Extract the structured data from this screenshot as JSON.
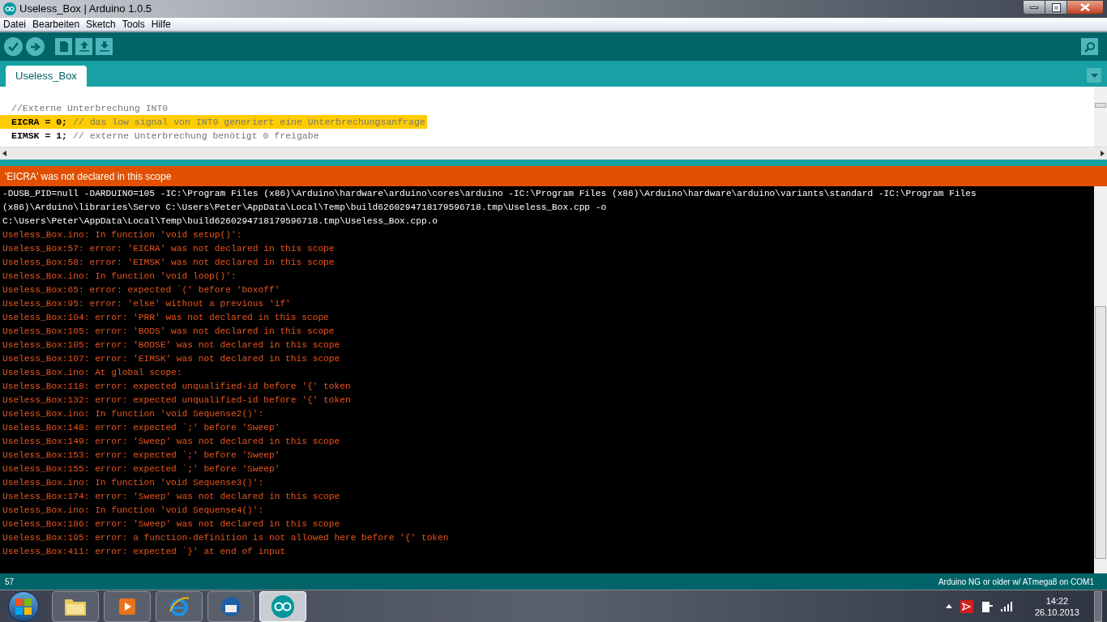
{
  "window": {
    "title": "Useless_Box | Arduino 1.0.5"
  },
  "menu": [
    "Datei",
    "Bearbeiten",
    "Sketch",
    "Tools",
    "Hilfe"
  ],
  "tabs": [
    {
      "label": "Useless_Box",
      "selected": true
    }
  ],
  "editor": {
    "lines": [
      {
        "comment": "//Externe Unterbrechung INT0",
        "highlighted": false
      },
      {
        "code": "EICRA = 0; ",
        "comment": "// das low signal von INT0 generiert eine Unterbrechungsanfrage",
        "highlighted": true
      },
      {
        "code": "EIMSK = 1; ",
        "comment": "// externe Unterbrechung benötigt 0 freigabe",
        "highlighted": false
      }
    ]
  },
  "message": "'EICRA' was not declared in this scope",
  "console": [
    {
      "kind": "info",
      "text": "-DUSB_PID=null -DARDUINO=105 -IC:\\Program Files (x86)\\Arduino\\hardware\\arduino\\cores\\arduino -IC:\\Program Files (x86)\\Arduino\\hardware\\arduino\\variants\\standard -IC:\\Program Files"
    },
    {
      "kind": "info",
      "text": "(x86)\\Arduino\\libraries\\Servo C:\\Users\\Peter\\AppData\\Local\\Temp\\build6260294718179596718.tmp\\Useless_Box.cpp -o"
    },
    {
      "kind": "info",
      "text": "C:\\Users\\Peter\\AppData\\Local\\Temp\\build6260294718179596718.tmp\\Useless_Box.cpp.o"
    },
    {
      "kind": "error",
      "text": "Useless_Box.ino: In function 'void setup()':"
    },
    {
      "kind": "error",
      "text": "Useless_Box:57: error: 'EICRA' was not declared in this scope"
    },
    {
      "kind": "error",
      "text": "Useless_Box:58: error: 'EIMSK' was not declared in this scope"
    },
    {
      "kind": "error",
      "text": "Useless_Box.ino: In function 'void loop()':"
    },
    {
      "kind": "error",
      "text": "Useless_Box:65: error: expected `(' before 'boxoff'"
    },
    {
      "kind": "error",
      "text": "Useless_Box:95: error: 'else' without a previous 'if'"
    },
    {
      "kind": "error",
      "text": "Useless_Box:104: error: 'PRR' was not declared in this scope"
    },
    {
      "kind": "error",
      "text": "Useless_Box:105: error: 'BODS' was not declared in this scope"
    },
    {
      "kind": "error",
      "text": "Useless_Box:105: error: 'BODSE' was not declared in this scope"
    },
    {
      "kind": "error",
      "text": "Useless_Box:107: error: 'EIMSK' was not declared in this scope"
    },
    {
      "kind": "error",
      "text": "Useless_Box.ino: At global scope:"
    },
    {
      "kind": "error",
      "text": "Useless_Box:118: error: expected unqualified-id before '{' token"
    },
    {
      "kind": "error",
      "text": "Useless_Box:132: error: expected unqualified-id before '{' token"
    },
    {
      "kind": "error",
      "text": "Useless_Box.ino: In function 'void Sequense2()':"
    },
    {
      "kind": "error",
      "text": "Useless_Box:148: error: expected `;' before 'Sweep'"
    },
    {
      "kind": "error",
      "text": "Useless_Box:149: error: 'Sweep' was not declared in this scope"
    },
    {
      "kind": "error",
      "text": "Useless_Box:153: error: expected `;' before 'Sweep'"
    },
    {
      "kind": "error",
      "text": "Useless_Box:155: error: expected `;' before 'Sweep'"
    },
    {
      "kind": "error",
      "text": "Useless_Box.ino: In function 'void Sequense3()':"
    },
    {
      "kind": "error",
      "text": "Useless_Box:174: error: 'Sweep' was not declared in this scope"
    },
    {
      "kind": "error",
      "text": "Useless_Box.ino: In function 'void Sequense4()':"
    },
    {
      "kind": "error",
      "text": "Useless_Box:186: error: 'Sweep' was not declared in this scope"
    },
    {
      "kind": "error",
      "text": "Useless_Box:195: error: a function-definition is not allowed here before '{' token"
    },
    {
      "kind": "error",
      "text": "Useless_Box:411: error: expected `}' at end of input"
    }
  ],
  "status_bar": {
    "line": "57",
    "board": "Arduino NG or older w/ ATmega8 on COM1"
  },
  "taskbar": {
    "apps": [
      {
        "kind": "folder",
        "selected": false
      },
      {
        "kind": "media",
        "selected": false
      },
      {
        "kind": "browser",
        "selected": false
      },
      {
        "kind": "mail",
        "selected": false
      },
      {
        "kind": "arduino",
        "selected": true
      }
    ],
    "time": "14:22",
    "date": "26.10.2013"
  }
}
